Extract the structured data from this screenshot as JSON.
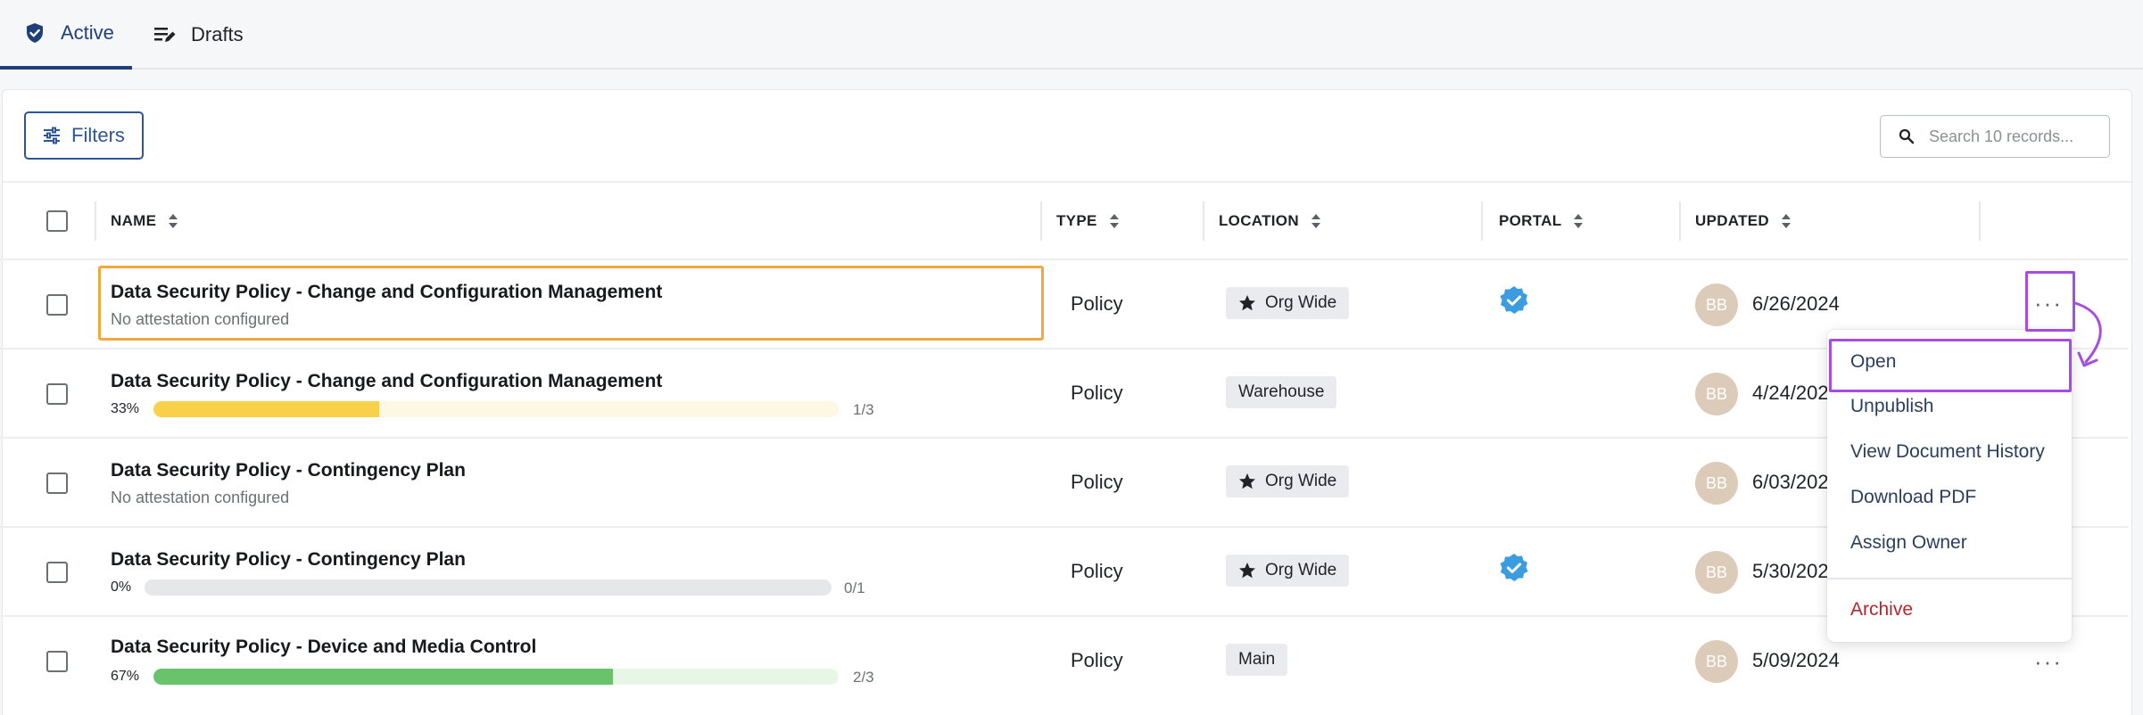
{
  "tabs": [
    {
      "label": "Active",
      "icon": "shield-check-icon",
      "active": true
    },
    {
      "label": "Drafts",
      "icon": "edit-list-icon",
      "active": false
    }
  ],
  "toolbar": {
    "filters_label": "Filters",
    "search_placeholder": "Search 10 records..."
  },
  "table": {
    "columns": [
      "NAME",
      "TYPE",
      "LOCATION",
      "PORTAL",
      "UPDATED"
    ],
    "rows": [
      {
        "title": "Data Security Policy - Change and Configuration Management",
        "subtitle": "No attestation configured",
        "type": "Policy",
        "location": "Org Wide",
        "location_starred": true,
        "portal_verified": true,
        "avatar": "BB",
        "updated": "6/26/2024"
      },
      {
        "title": "Data Security Policy - Change and Configuration Management",
        "progress_pct": "33%",
        "progress_value": 0.33,
        "progress_frac": "1/3",
        "progress_color": "#f9d04a",
        "progress_track": "#fdf8e4",
        "type": "Policy",
        "location": "Warehouse",
        "location_starred": false,
        "portal_verified": false,
        "avatar": "BB",
        "updated": "4/24/202"
      },
      {
        "title": "Data Security Policy - Contingency Plan",
        "subtitle": "No attestation configured",
        "type": "Policy",
        "location": "Org Wide",
        "location_starred": true,
        "portal_verified": false,
        "avatar": "BB",
        "updated": "6/03/202"
      },
      {
        "title": "Data Security Policy - Contingency Plan",
        "progress_pct": "0%",
        "progress_value": 0,
        "progress_frac": "0/1",
        "progress_color": "#cfd2d6",
        "progress_track": "#e6e7e9",
        "type": "Policy",
        "location": "Org Wide",
        "location_starred": true,
        "portal_verified": true,
        "avatar": "BB",
        "updated": "5/30/202"
      },
      {
        "title": "Data Security Policy - Device and Media Control",
        "progress_pct": "67%",
        "progress_value": 0.67,
        "progress_frac": "2/3",
        "progress_color": "#69c36a",
        "progress_track": "#e8f6e8",
        "type": "Policy",
        "location": "Main",
        "location_starred": false,
        "portal_verified": false,
        "avatar": "BB",
        "updated": "5/09/2024"
      }
    ]
  },
  "menu": {
    "items": [
      "Open",
      "Unpublish",
      "View Document History",
      "Download PDF",
      "Assign Owner"
    ],
    "danger_item": "Archive"
  },
  "colors": {
    "brand": "#1f3f7a",
    "highlight_orange": "#f2a93b",
    "highlight_purple": "#a64ce3",
    "danger": "#b3262e",
    "verified": "#3b9de0"
  }
}
